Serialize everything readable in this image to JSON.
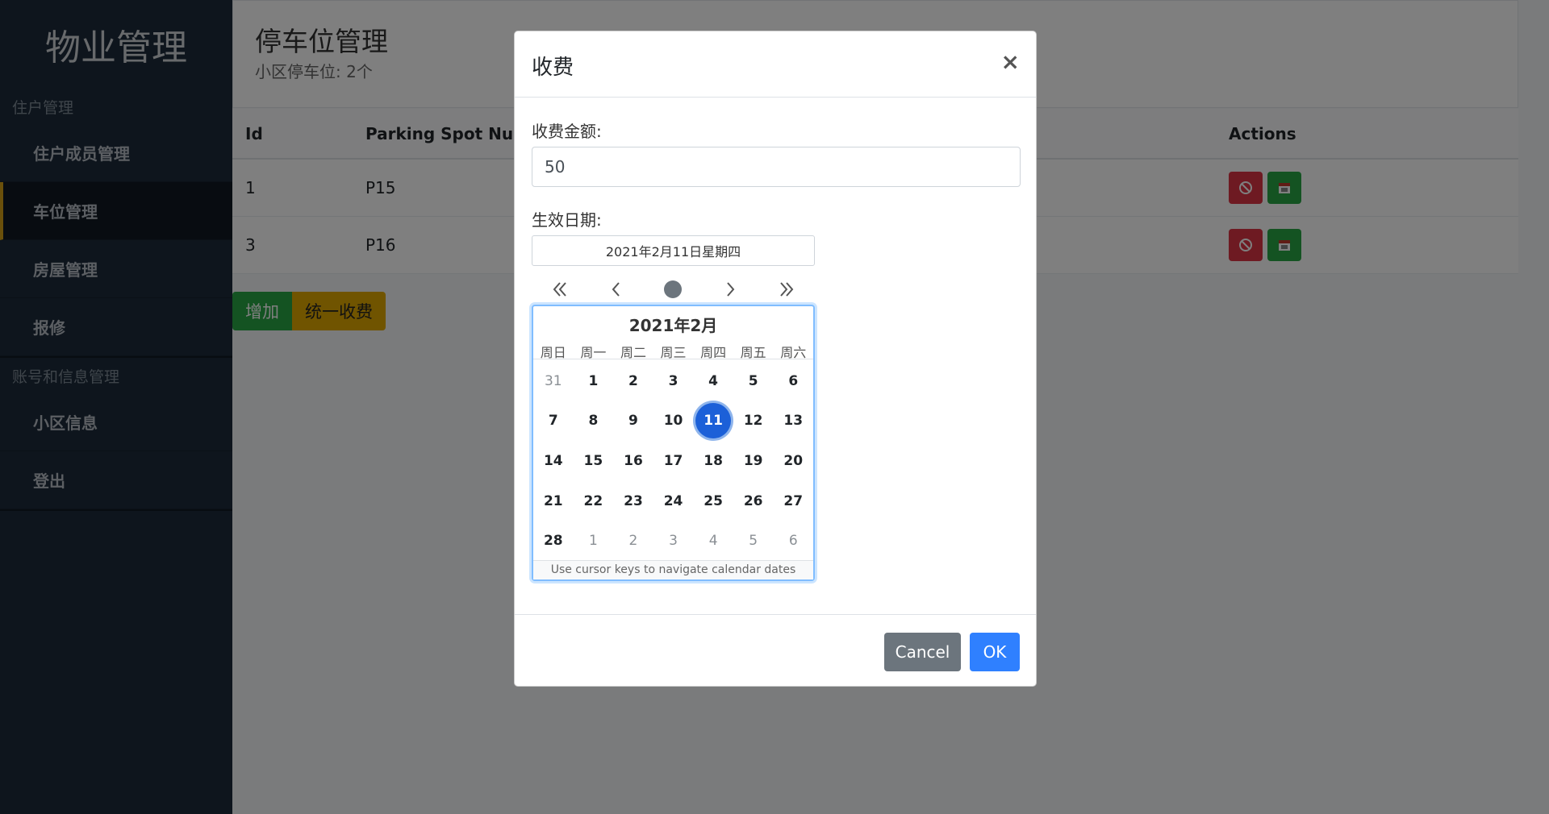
{
  "sidebar": {
    "brand": "物业管理",
    "sections": [
      {
        "title": "住户管理",
        "items": [
          {
            "label": "住户成员管理",
            "active": false
          },
          {
            "label": "车位管理",
            "active": true
          },
          {
            "label": "房屋管理",
            "active": false
          },
          {
            "label": "报修",
            "active": false
          }
        ]
      },
      {
        "title": "账号和信息管理",
        "items": [
          {
            "label": "小区信息",
            "active": false
          },
          {
            "label": "登出",
            "active": false
          }
        ]
      }
    ]
  },
  "header": {
    "title": "停车位管理",
    "subtitle": "小区停车位: 2个"
  },
  "table": {
    "columns": {
      "id": "Id",
      "spot": "Parking Spot Numb",
      "actions": "Actions"
    },
    "rows": [
      {
        "id": "1",
        "spot": "P15"
      },
      {
        "id": "3",
        "spot": "P16"
      }
    ]
  },
  "buttons": {
    "add": "增加",
    "charge_all": "统一收费"
  },
  "modal": {
    "title": "收费",
    "close_icon": "close-icon",
    "amount_label": "收费金额:",
    "amount_value": "50",
    "date_label": "生效日期:",
    "date_display": "2021年2月11日星期四",
    "calendar": {
      "month_title": "2021年2月",
      "weekdays": [
        "周日",
        "周一",
        "周二",
        "周三",
        "周四",
        "周五",
        "周六"
      ],
      "weeks": [
        [
          "31",
          "1",
          "2",
          "3",
          "4",
          "5",
          "6"
        ],
        [
          "7",
          "8",
          "9",
          "10",
          "11",
          "12",
          "13"
        ],
        [
          "14",
          "15",
          "16",
          "17",
          "18",
          "19",
          "20"
        ],
        [
          "21",
          "22",
          "23",
          "24",
          "25",
          "26",
          "27"
        ],
        [
          "28",
          "1",
          "2",
          "3",
          "4",
          "5",
          "6"
        ]
      ],
      "selected": "11",
      "footer": "Use cursor keys to navigate calendar dates"
    },
    "cancel_label": "Cancel",
    "ok_label": "OK"
  },
  "colors": {
    "sidebar_bg": "#1c2b3a",
    "active_accent": "#d4a017",
    "danger": "#dc3545",
    "success": "#28a745",
    "warning": "#e0a800",
    "primary": "#2f80ff",
    "selected_day": "#1c60d8"
  }
}
